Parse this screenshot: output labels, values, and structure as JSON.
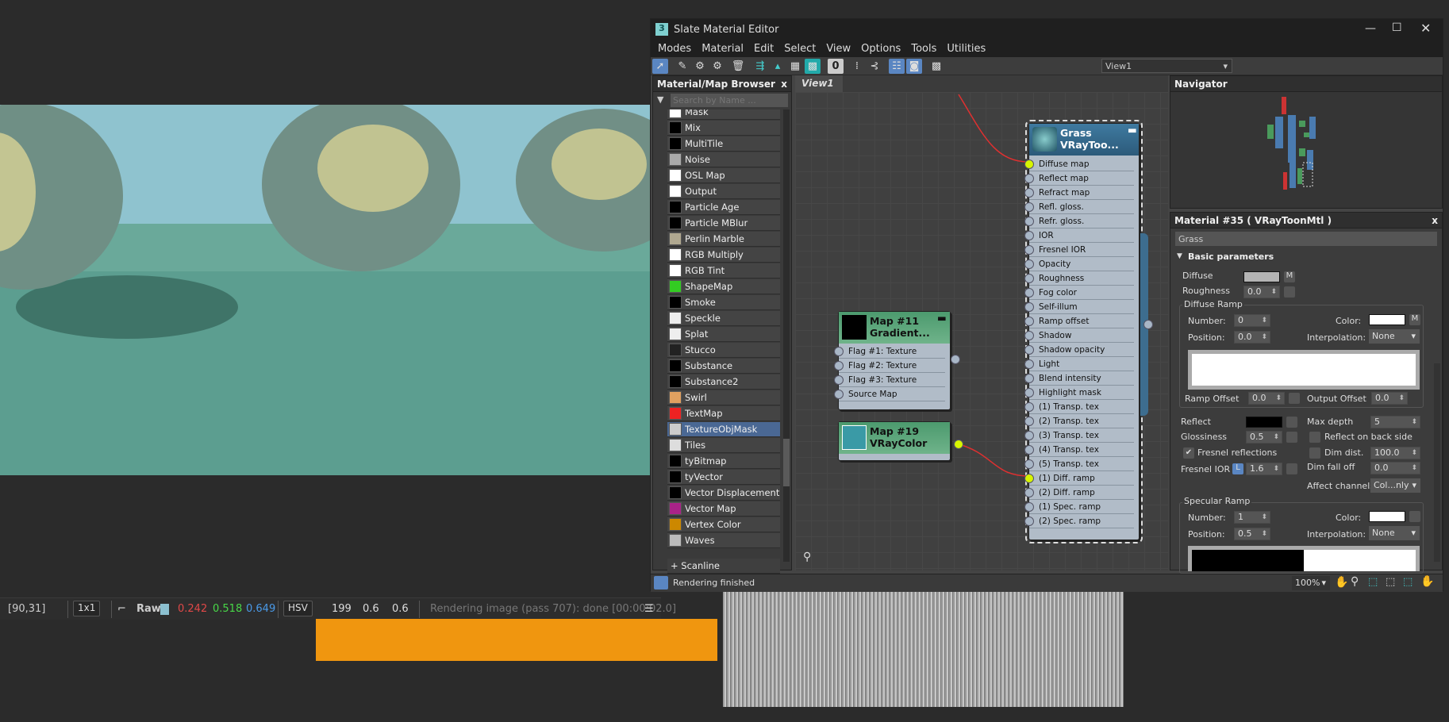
{
  "viewport": {
    "status": {
      "coords": "[90,31]",
      "sampling": "1x1",
      "mode": "Raw",
      "r": "0.242",
      "g": "0.518",
      "b": "0.649",
      "colorspace": "HSV",
      "h": "199",
      "s": "0.6",
      "v": "0.6",
      "message": "Rendering image (pass 707): done [00:00:02.0]",
      "swatch": "#8cc0d0"
    }
  },
  "editor": {
    "title": "Slate Material Editor",
    "menu": [
      "Modes",
      "Material",
      "Edit",
      "Select",
      "View",
      "Options",
      "Tools",
      "Utilities"
    ],
    "view_dropdown": "View1",
    "browser": {
      "title": "Material/Map Browser",
      "close": "x",
      "search_placeholder": "Search by Name ...",
      "items": [
        {
          "label": "Mask",
          "thumb": "#ffffff"
        },
        {
          "label": "Mix",
          "thumb": "#000000"
        },
        {
          "label": "MultiTile",
          "thumb": "#000000"
        },
        {
          "label": "Noise",
          "thumb": "#aaaaaa"
        },
        {
          "label": "OSL Map",
          "thumb": "#ffffff"
        },
        {
          "label": "Output",
          "thumb": "#ffffff"
        },
        {
          "label": "Particle Age",
          "thumb": "#000000"
        },
        {
          "label": "Particle MBlur",
          "thumb": "#000000"
        },
        {
          "label": "Perlin Marble",
          "thumb": "#b0a890"
        },
        {
          "label": "RGB Multiply",
          "thumb": "#ffffff"
        },
        {
          "label": "RGB Tint",
          "thumb": "#ffffff"
        },
        {
          "label": "ShapeMap",
          "thumb": "#33cc22"
        },
        {
          "label": "Smoke",
          "thumb": "#000000"
        },
        {
          "label": "Speckle",
          "thumb": "#eeeeee"
        },
        {
          "label": "Splat",
          "thumb": "#eeeeee"
        },
        {
          "label": "Stucco",
          "thumb": "#222222"
        },
        {
          "label": "Substance",
          "thumb": "#000000"
        },
        {
          "label": "Substance2",
          "thumb": "#000000"
        },
        {
          "label": "Swirl",
          "thumb": "#e0a060"
        },
        {
          "label": "TextMap",
          "thumb": "#ee2222"
        },
        {
          "label": "TextureObjMask",
          "thumb": "#cccccc",
          "selected": true
        },
        {
          "label": "Tiles",
          "thumb": "#dddddd"
        },
        {
          "label": "tyBitmap",
          "thumb": "#000000"
        },
        {
          "label": "tyVector",
          "thumb": "#000000"
        },
        {
          "label": "Vector Displacement",
          "thumb": "#000000"
        },
        {
          "label": "Vector Map",
          "thumb": "#aa2288"
        },
        {
          "label": "Vertex Color",
          "thumb": "#cc8800"
        },
        {
          "label": "Waves",
          "thumb": "#bbbbbb"
        }
      ],
      "group": "+ Scanline"
    },
    "view_tab": "View1",
    "nodes": {
      "grass": {
        "name": "Grass",
        "type": "VRayToo...",
        "slots": [
          "Diffuse map",
          "Reflect map",
          "Refract map",
          "Refl. gloss.",
          "Refr. gloss.",
          "IOR",
          "Fresnel IOR",
          "Opacity",
          "Roughness",
          "Fog color",
          "Self-illum",
          "Ramp offset",
          "Shadow",
          "Shadow opacity",
          "Light",
          "Blend intensity",
          "Highlight mask",
          "(1) Transp. tex",
          "(2) Transp. tex",
          "(3) Transp. tex",
          "(4) Transp. tex",
          "(5) Transp. tex",
          "(1) Diff. ramp",
          "(2) Diff. ramp",
          "(1) Spec. ramp",
          "(2) Spec. ramp"
        ],
        "connected": [
          "Diffuse map",
          "(1) Diff. ramp"
        ]
      },
      "map11": {
        "name": "Map #11",
        "type": "Gradient...",
        "slots": [
          "Flag #1: Texture",
          "Flag #2: Texture",
          "Flag #3: Texture",
          "Source Map"
        ]
      },
      "map19": {
        "name": "Map #19",
        "type": "VRayColor",
        "color": "#3a9aa6"
      }
    },
    "navigator": {
      "title": "Navigator"
    },
    "material": {
      "title": "Material #35  ( VRayToonMtl )",
      "close": "x",
      "name": "Grass",
      "rollout": "Basic parameters",
      "diffuse_label": "Diffuse",
      "diffuse_color": "#b4b4b4",
      "m": "M",
      "roughness_label": "Roughness",
      "roughness": "0.0",
      "diffuse_ramp": {
        "title": "Diffuse Ramp",
        "number_label": "Number:",
        "number": "0",
        "position_label": "Position:",
        "position": "0.0",
        "color_label": "Color:",
        "color": "#ffffff",
        "interp_label": "Interpolation:",
        "interp": "None",
        "ramp_offset_label": "Ramp Offset",
        "ramp_offset": "0.0",
        "output_offset_label": "Output Offset",
        "output_offset": "0.0"
      },
      "reflect_label": "Reflect",
      "reflect_color": "#000000",
      "glossiness_label": "Glossiness",
      "glossiness": "0.5",
      "fresnel_label": "Fresnel reflections",
      "fresnel_checked": true,
      "fresnel_ior_label": "Fresnel IOR",
      "lock": "L",
      "fresnel_ior": "1.6",
      "max_depth_label": "Max depth",
      "max_depth": "5",
      "back_side_label": "Reflect on back side",
      "dim_dist_label": "Dim dist.",
      "dim_dist": "100.0",
      "dim_falloff_label": "Dim fall off",
      "dim_falloff": "0.0",
      "affect_label": "Affect channels",
      "affect": "Col...nly",
      "spec_ramp": {
        "title": "Specular Ramp",
        "number_label": "Number:",
        "number": "1",
        "position_label": "Position:",
        "position": "0.5",
        "color_label": "Color:",
        "color": "#ffffff",
        "interp_label": "Interpolation:",
        "interp": "None"
      }
    },
    "status": {
      "message": "Rendering finished",
      "zoom": "100%"
    }
  }
}
